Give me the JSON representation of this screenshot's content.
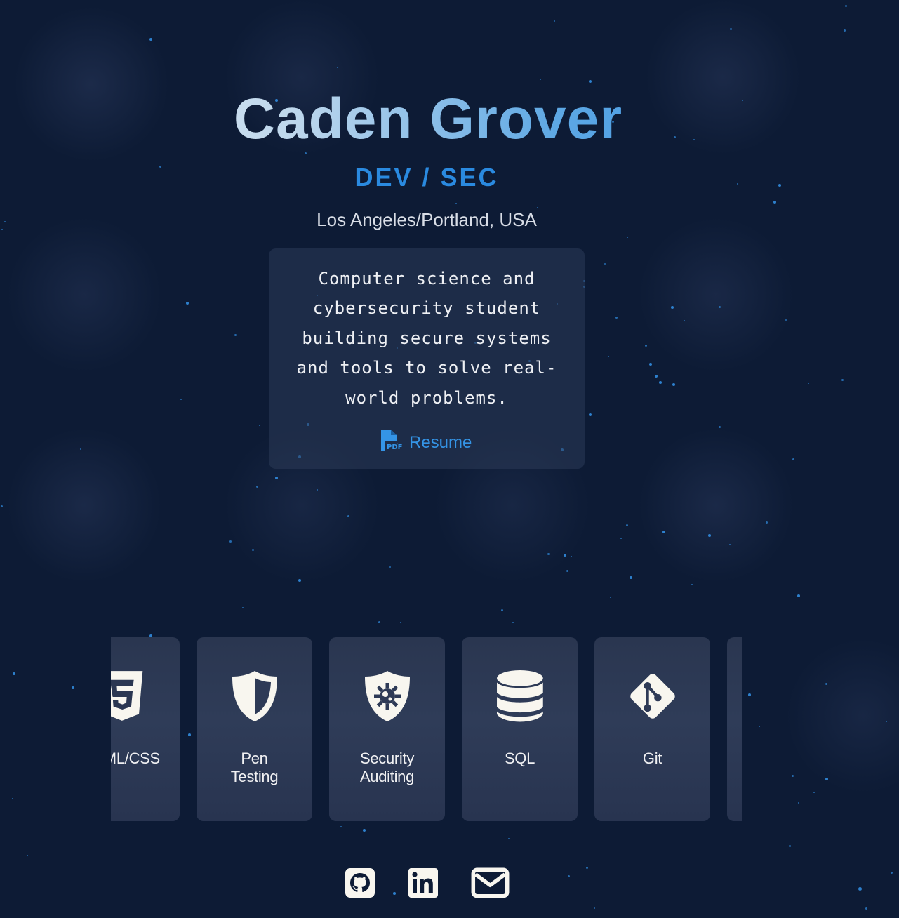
{
  "hero": {
    "name": "Caden Grover",
    "role": "DEV / SEC",
    "location": "Los Angeles/Portland, USA"
  },
  "bio": {
    "text": "Computer science and cybersecurity student building secure systems and tools to solve real-world problems.",
    "resume_label": "Resume",
    "resume_icon": "file-pdf-icon"
  },
  "skills": [
    {
      "label": "HTML/CSS",
      "icon": "css3-icon"
    },
    {
      "label": "Pen Testing",
      "icon": "shield-icon"
    },
    {
      "label": "Security Auditing",
      "icon": "shield-virus-icon"
    },
    {
      "label": "SQL",
      "icon": "database-icon"
    },
    {
      "label": "Git",
      "icon": "git-icon"
    },
    {
      "label": "",
      "icon": ""
    }
  ],
  "social": [
    {
      "name": "GitHub",
      "icon": "github-icon"
    },
    {
      "name": "LinkedIn",
      "icon": "linkedin-icon"
    },
    {
      "name": "Email",
      "icon": "envelope-icon"
    }
  ],
  "colors": {
    "background": "#0d1b35",
    "accent": "#2a8ae0",
    "card": "#2a3650",
    "particle": "#2f86d6",
    "icon": "#f8f6ef"
  }
}
